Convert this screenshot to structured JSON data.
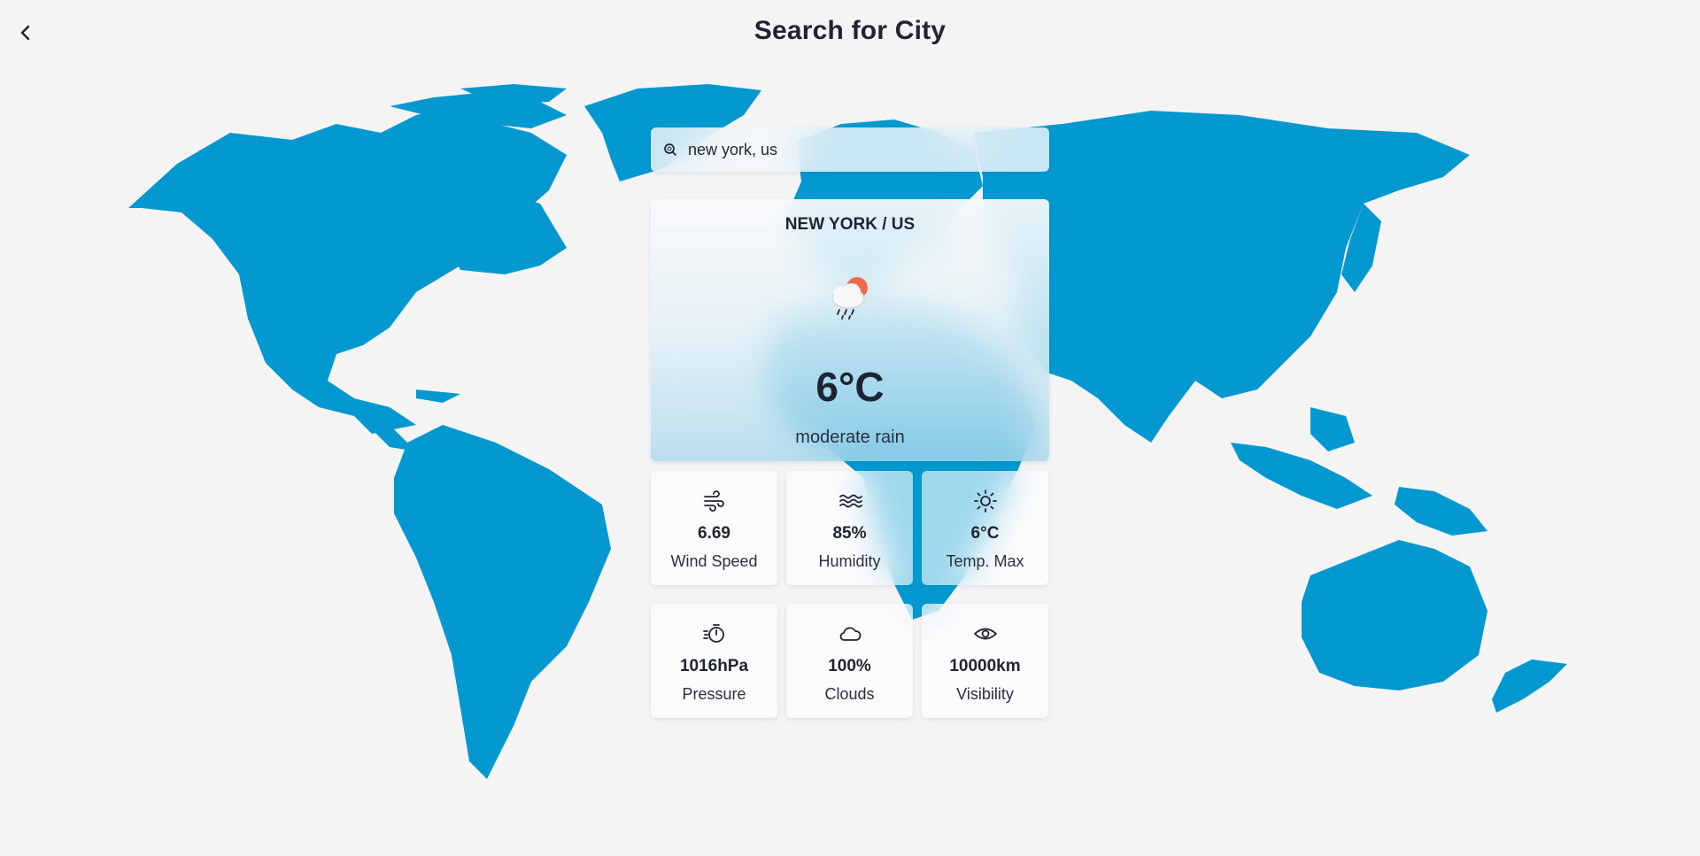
{
  "header": {
    "title": "Search for City",
    "back_icon": "chevron-left-icon"
  },
  "search": {
    "icon": "search-icon",
    "value": "new york, us",
    "placeholder": ""
  },
  "weather": {
    "city": "NEW YORK / US",
    "icon": "rain-cloud-sun-icon",
    "temperature": "6°C",
    "description": "moderate rain"
  },
  "stats": [
    {
      "icon": "wind-icon",
      "value": "6.69",
      "label": "Wind Speed"
    },
    {
      "icon": "waves-icon",
      "value": "85%",
      "label": "Humidity"
    },
    {
      "icon": "sun-icon",
      "value": "6°C",
      "label": "Temp. Max"
    },
    {
      "icon": "stopwatch-icon",
      "value": "1016hPa",
      "label": "Pressure"
    },
    {
      "icon": "cloud-icon",
      "value": "100%",
      "label": "Clouds"
    },
    {
      "icon": "eye-icon",
      "value": "10000km",
      "label": "Visibility"
    }
  ],
  "colors": {
    "map": "#0399d0",
    "background": "#f4f4f5",
    "text": "#1f2433",
    "sun": "#ef6a4a"
  }
}
